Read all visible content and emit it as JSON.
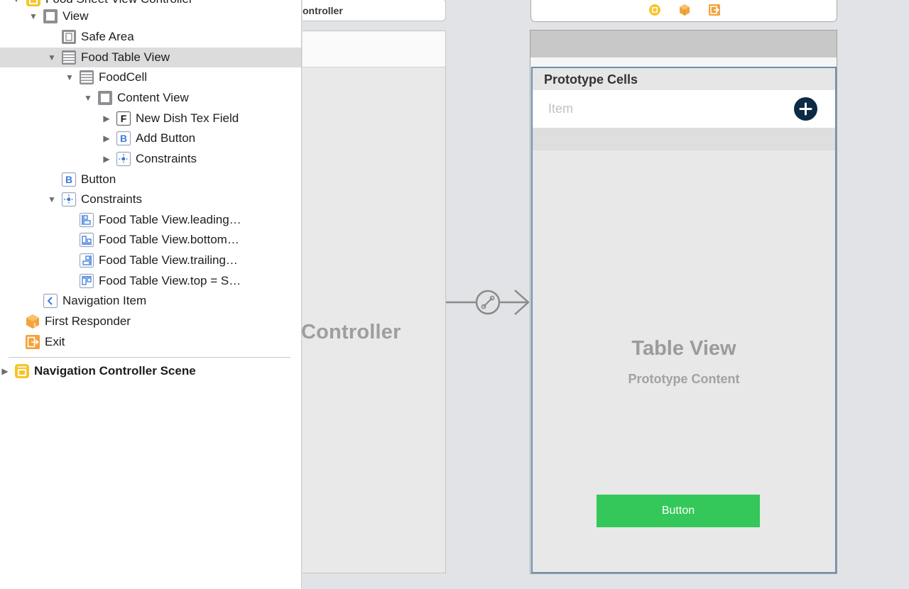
{
  "outline": {
    "rows": [
      {
        "key": "vc",
        "label": "Food Sheet View Controller",
        "icon": "view-controller-icon",
        "expanded": true
      },
      {
        "key": "view",
        "label": "View",
        "icon": "view-icon",
        "expanded": true
      },
      {
        "key": "safe",
        "label": "Safe Area",
        "icon": "safe-area-icon"
      },
      {
        "key": "table",
        "label": "Food Table View",
        "icon": "table-view-icon",
        "expanded": true,
        "selected": true
      },
      {
        "key": "cell",
        "label": "FoodCell",
        "icon": "table-cell-icon",
        "expanded": true
      },
      {
        "key": "content",
        "label": "Content View",
        "icon": "view-icon",
        "expanded": true
      },
      {
        "key": "textfield",
        "label": "New Dish Tex Field",
        "icon": "text-field-icon",
        "icon_letter": "F",
        "expanded": false
      },
      {
        "key": "addbutton",
        "label": "Add Button",
        "icon": "button-icon",
        "icon_letter": "B",
        "expanded": false
      },
      {
        "key": "cellconstraints",
        "label": "Constraints",
        "icon": "constraints-icon",
        "expanded": false
      },
      {
        "key": "button",
        "label": "Button",
        "icon": "button-icon",
        "icon_letter": "B"
      },
      {
        "key": "constraints",
        "label": "Constraints",
        "icon": "constraints-icon",
        "expanded": true
      },
      {
        "key": "c1",
        "label": "Food Table View.leading…",
        "icon": "leading-constraint-icon"
      },
      {
        "key": "c2",
        "label": "Food Table View.bottom…",
        "icon": "bottom-constraint-icon"
      },
      {
        "key": "c3",
        "label": "Food Table View.trailing…",
        "icon": "trailing-constraint-icon"
      },
      {
        "key": "c4",
        "label": "Food Table View.top = S…",
        "icon": "top-constraint-icon"
      },
      {
        "key": "navitem",
        "label": "Navigation Item",
        "icon": "navigation-item-icon"
      },
      {
        "key": "responder",
        "label": "First Responder",
        "icon": "first-responder-icon"
      },
      {
        "key": "exit",
        "label": "Exit",
        "icon": "exit-icon"
      },
      {
        "key": "navscene",
        "label": "Navigation Controller Scene",
        "icon": "navigation-controller-icon",
        "expanded": false
      }
    ]
  },
  "canvas": {
    "nav_controller": {
      "title_bar_label": "ontroller",
      "big_label": "Controller"
    },
    "table_scene": {
      "dock_icons": [
        "view-controller-icon",
        "first-responder-icon",
        "exit-icon"
      ],
      "prototype_cells_label": "Prototype Cells",
      "cell_placeholder": "Item",
      "add_button_icon": "plus-icon",
      "table_view_title": "Table View",
      "table_view_subtitle": "Prototype Content",
      "button_label": "Button"
    },
    "segue_icon": "segue-link-icon"
  },
  "colors": {
    "selection": "#dcdcdc",
    "table_border": "#6b8fb7",
    "green_button": "#34c85a",
    "add_button": "#0c2a45",
    "icon_blue": "#3d7be0",
    "icon_orange": "#f2a33a",
    "icon_yellow": "#f7c52b"
  }
}
